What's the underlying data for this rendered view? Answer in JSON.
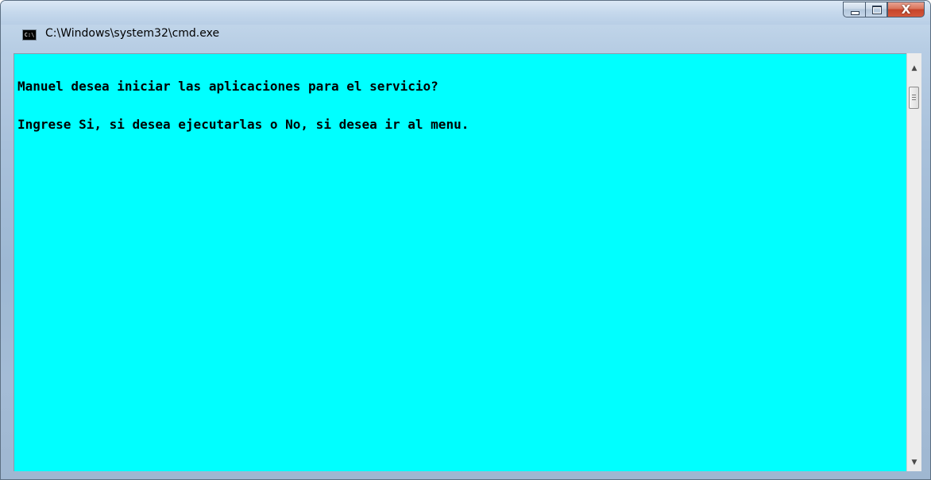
{
  "window": {
    "title": "C:\\Windows\\system32\\cmd.exe",
    "icon_text": "C:\\",
    "icon_name": "cmd-icon"
  },
  "caption_buttons": {
    "minimize_icon": "minimize-icon",
    "maximize_icon": "maximize-icon",
    "close_glyph": "X"
  },
  "console": {
    "background_color": "#00ffff",
    "text_color": "#000000",
    "lines": [
      "Manuel desea iniciar las aplicaciones para el servicio?",
      "Ingrese Si, si desea ejecutarlas o No, si desea ir al menu."
    ]
  },
  "scrollbar": {
    "up_arrow": "▲",
    "down_arrow": "▼"
  }
}
